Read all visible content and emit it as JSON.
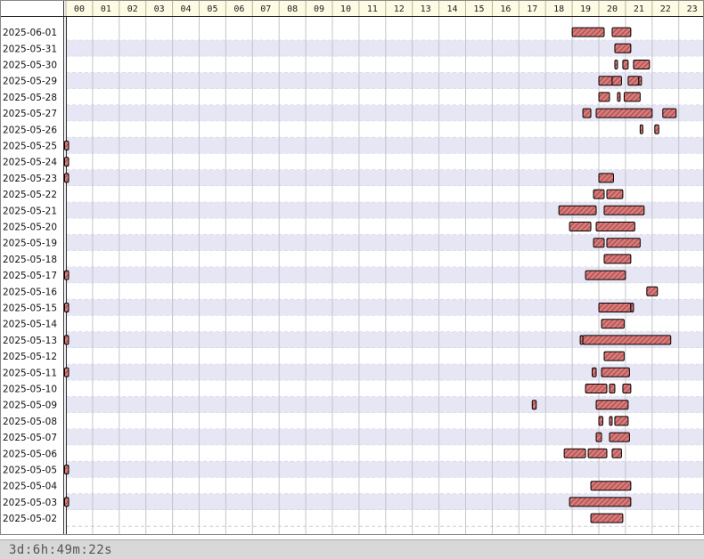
{
  "colors": {
    "header_bg": "#fdfbe4",
    "row_band": "#e6e6f4",
    "row_plain": "#ffffff",
    "bar_fill": "#d77a7a",
    "bar_hatch": "#9c3a3a",
    "bar_border": "#000000",
    "grid": "#c4c4cc",
    "footer_bg": "#d8d8d8"
  },
  "footer": {
    "duration": "3d:6h:49m:22s"
  },
  "chart_data": {
    "type": "gantt",
    "x_ticks": [
      "00",
      "01",
      "02",
      "03",
      "04",
      "05",
      "06",
      "07",
      "08",
      "09",
      "10",
      "11",
      "12",
      "13",
      "14",
      "15",
      "16",
      "17",
      "18",
      "19",
      "20",
      "21",
      "22",
      "23"
    ],
    "xlim": [
      0,
      24
    ],
    "rows": [
      {
        "date": "2025-06-01",
        "intervals": [
          [
            19.0,
            20.2
          ],
          [
            20.5,
            21.2
          ]
        ]
      },
      {
        "date": "2025-05-31",
        "intervals": [
          [
            20.6,
            21.2
          ]
        ]
      },
      {
        "date": "2025-05-30",
        "intervals": [
          [
            20.6,
            20.7
          ],
          [
            20.9,
            21.1
          ],
          [
            21.3,
            21.9
          ]
        ]
      },
      {
        "date": "2025-05-29",
        "intervals": [
          [
            20.0,
            20.5
          ],
          [
            20.5,
            20.85
          ],
          [
            21.1,
            21.5
          ],
          [
            21.5,
            21.55
          ]
        ]
      },
      {
        "date": "2025-05-28",
        "intervals": [
          [
            20.0,
            20.4
          ],
          [
            20.7,
            20.8
          ],
          [
            20.95,
            21.55
          ]
        ]
      },
      {
        "date": "2025-05-27",
        "intervals": [
          [
            19.4,
            19.7
          ],
          [
            19.9,
            22.0
          ],
          [
            22.4,
            22.9
          ]
        ]
      },
      {
        "date": "2025-05-26",
        "intervals": [
          [
            21.55,
            21.65
          ],
          [
            22.1,
            22.25
          ]
        ]
      },
      {
        "date": "2025-05-25",
        "intervals": [
          [
            -0.05,
            0.1
          ]
        ]
      },
      {
        "date": "2025-05-24",
        "intervals": [
          [
            -0.05,
            0.1
          ]
        ]
      },
      {
        "date": "2025-05-23",
        "intervals": [
          [
            -0.05,
            0.1
          ],
          [
            20.0,
            20.55
          ]
        ]
      },
      {
        "date": "2025-05-22",
        "intervals": [
          [
            19.8,
            20.2
          ],
          [
            20.3,
            20.9
          ]
        ]
      },
      {
        "date": "2025-05-21",
        "intervals": [
          [
            18.5,
            19.9
          ],
          [
            20.2,
            21.7
          ]
        ]
      },
      {
        "date": "2025-05-20",
        "intervals": [
          [
            18.9,
            19.7
          ],
          [
            19.9,
            21.35
          ]
        ]
      },
      {
        "date": "2025-05-19",
        "intervals": [
          [
            19.8,
            20.2
          ],
          [
            20.3,
            21.55
          ]
        ]
      },
      {
        "date": "2025-05-18",
        "intervals": [
          [
            20.2,
            21.2
          ]
        ]
      },
      {
        "date": "2025-05-17",
        "intervals": [
          [
            -0.05,
            0.1
          ],
          [
            19.5,
            21.0
          ]
        ]
      },
      {
        "date": "2025-05-16",
        "intervals": [
          [
            21.8,
            22.2
          ]
        ]
      },
      {
        "date": "2025-05-15",
        "intervals": [
          [
            -0.05,
            0.1
          ],
          [
            20.0,
            21.2
          ],
          [
            21.2,
            21.3
          ]
        ]
      },
      {
        "date": "2025-05-14",
        "intervals": [
          [
            20.1,
            20.95
          ]
        ]
      },
      {
        "date": "2025-05-13",
        "intervals": [
          [
            -0.05,
            0.1
          ],
          [
            19.3,
            19.4
          ],
          [
            19.4,
            22.7
          ]
        ]
      },
      {
        "date": "2025-05-12",
        "intervals": [
          [
            20.2,
            20.95
          ]
        ]
      },
      {
        "date": "2025-05-11",
        "intervals": [
          [
            -0.05,
            0.1
          ],
          [
            19.75,
            19.9
          ],
          [
            20.1,
            21.15
          ]
        ]
      },
      {
        "date": "2025-05-10",
        "intervals": [
          [
            19.5,
            20.3
          ],
          [
            20.4,
            20.6
          ],
          [
            20.9,
            21.2
          ]
        ]
      },
      {
        "date": "2025-05-09",
        "intervals": [
          [
            17.5,
            17.65
          ],
          [
            19.9,
            21.1
          ]
        ]
      },
      {
        "date": "2025-05-08",
        "intervals": [
          [
            20.0,
            20.15
          ],
          [
            20.4,
            20.5
          ],
          [
            20.6,
            21.1
          ]
        ]
      },
      {
        "date": "2025-05-07",
        "intervals": [
          [
            19.9,
            20.1
          ],
          [
            20.4,
            21.15
          ]
        ]
      },
      {
        "date": "2025-05-06",
        "intervals": [
          [
            18.7,
            19.5
          ],
          [
            19.6,
            20.3
          ],
          [
            20.5,
            20.85
          ]
        ]
      },
      {
        "date": "2025-05-05",
        "intervals": [
          [
            -0.05,
            0.1
          ]
        ]
      },
      {
        "date": "2025-05-04",
        "intervals": [
          [
            19.7,
            21.2
          ]
        ]
      },
      {
        "date": "2025-05-03",
        "intervals": [
          [
            -0.05,
            0.1
          ],
          [
            18.9,
            21.2
          ]
        ]
      },
      {
        "date": "2025-05-02",
        "intervals": [
          [
            19.7,
            20.9
          ]
        ]
      }
    ]
  }
}
